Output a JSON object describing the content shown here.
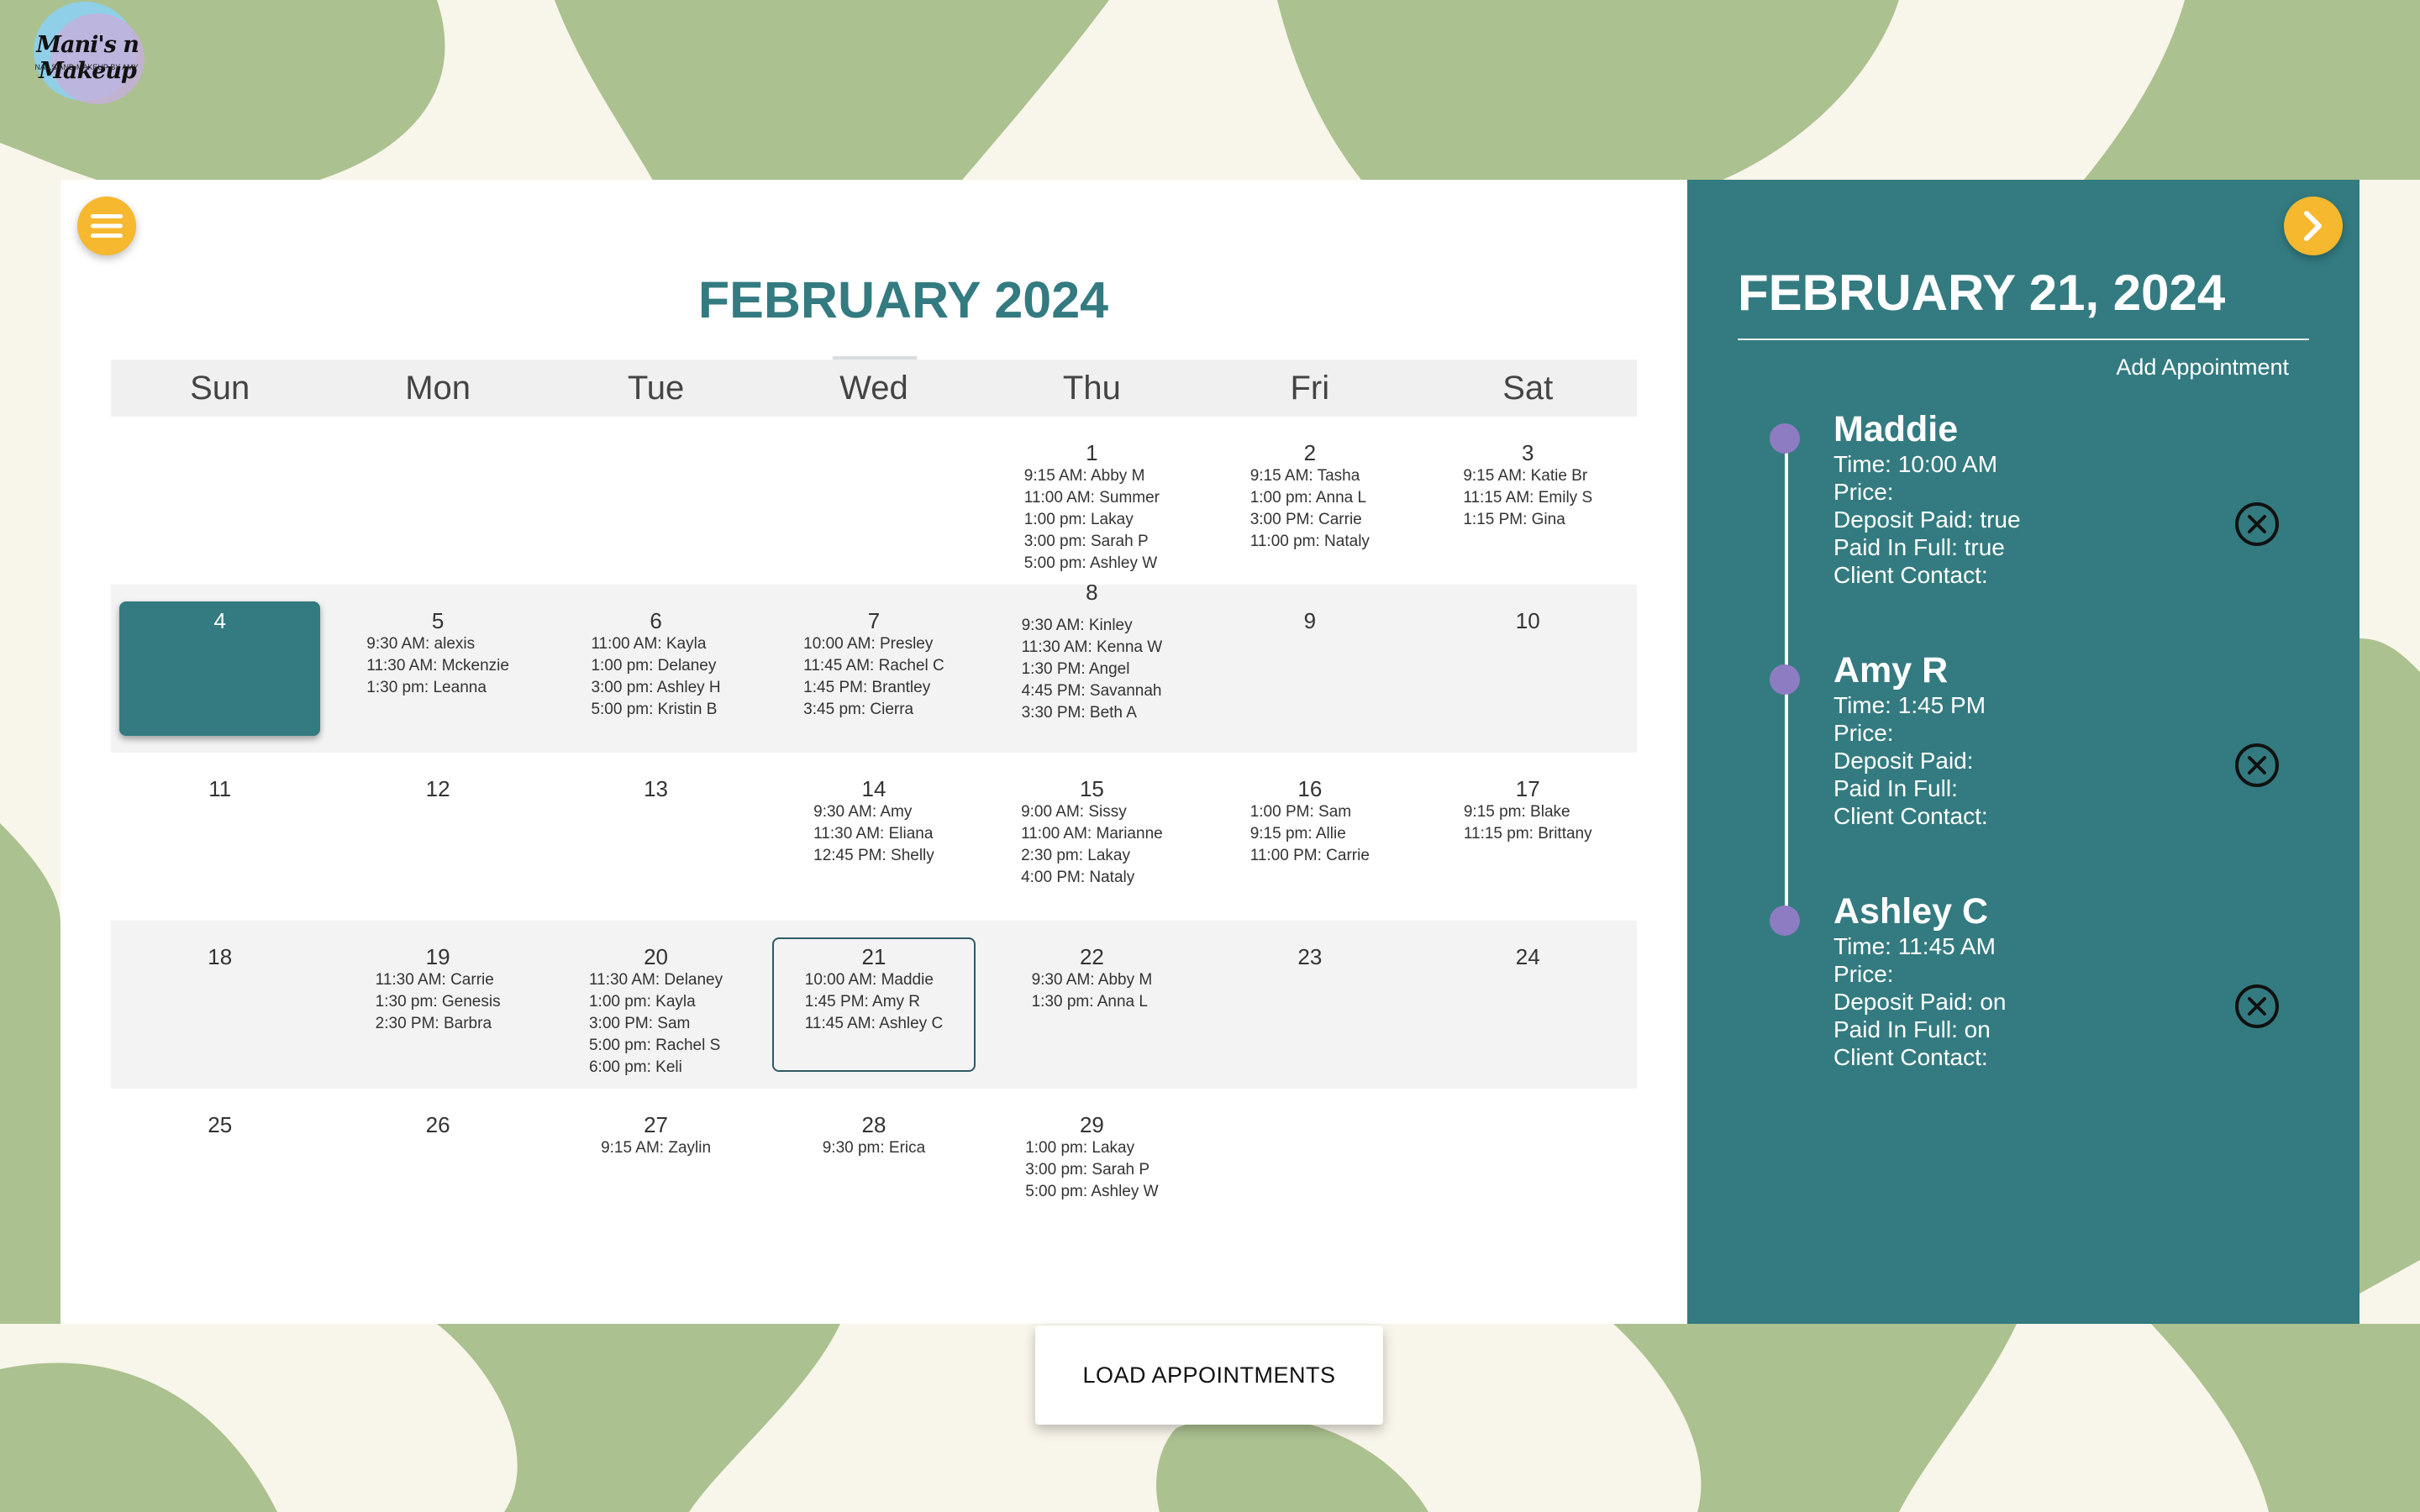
{
  "logo": {
    "name": "Mani's n Makeup",
    "tagline": "NAILS AND MAKEUP BY AMY"
  },
  "calendar": {
    "title": "FEBRUARY 2024",
    "days": [
      "Sun",
      "Mon",
      "Tue",
      "Wed",
      "Thu",
      "Fri",
      "Sat"
    ],
    "weeks": [
      [
        {
          "day": "",
          "appts": []
        },
        {
          "day": "",
          "appts": []
        },
        {
          "day": "",
          "appts": []
        },
        {
          "day": "",
          "appts": []
        },
        {
          "day": "1",
          "appts": [
            "9:15 AM: Abby M",
            "11:00 AM: Summer",
            "1:00 pm: Lakay",
            "3:00 pm: Sarah P",
            "5:00 pm: Ashley W"
          ]
        },
        {
          "day": "2",
          "appts": [
            "9:15 AM: Tasha",
            "1:00 pm: Anna L",
            "3:00 PM: Carrie",
            "11:00 pm: Nataly"
          ]
        },
        {
          "day": "3",
          "appts": [
            "9:15 AM: Katie Br",
            "11:15 AM: Emily S",
            "1:15 PM: Gina"
          ]
        }
      ],
      [
        {
          "day": "4",
          "appts": [],
          "today": true
        },
        {
          "day": "5",
          "appts": [
            "9:30 AM: alexis",
            "11:30 AM: Mckenzie",
            "1:30 pm: Leanna"
          ]
        },
        {
          "day": "6",
          "appts": [
            "11:00 AM: Kayla",
            "1:00 pm: Delaney",
            "3:00 pm: Ashley H",
            "5:00 pm: Kristin B"
          ]
        },
        {
          "day": "7",
          "appts": [
            "10:00 AM: Presley",
            "11:45 AM: Rachel C",
            "1:45 PM: Brantley",
            "3:45 pm: Cierra"
          ]
        },
        {
          "day": "8",
          "appts": [
            "9:30 AM: Kinley",
            "11:30 AM: Kenna W",
            "1:30 PM: Angel",
            "4:45 PM: Savannah",
            "3:30 PM: Beth A"
          ],
          "overflow": true
        },
        {
          "day": "9",
          "appts": []
        },
        {
          "day": "10",
          "appts": []
        }
      ],
      [
        {
          "day": "11",
          "appts": []
        },
        {
          "day": "12",
          "appts": []
        },
        {
          "day": "13",
          "appts": []
        },
        {
          "day": "14",
          "appts": [
            "9:30 AM: Amy",
            "11:30 AM: Eliana",
            "12:45 PM: Shelly"
          ]
        },
        {
          "day": "15",
          "appts": [
            "9:00 AM: Sissy",
            "11:00 AM: Marianne",
            "2:30 pm: Lakay",
            "4:00 PM: Nataly"
          ]
        },
        {
          "day": "16",
          "appts": [
            "1:00 PM: Sam",
            "9:15 pm: Allie",
            "11:00 PM: Carrie"
          ]
        },
        {
          "day": "17",
          "appts": [
            "9:15 pm: Blake",
            "11:15 pm: Brittany"
          ]
        }
      ],
      [
        {
          "day": "18",
          "appts": []
        },
        {
          "day": "19",
          "appts": [
            "11:30 AM: Carrie",
            "1:30 pm: Genesis",
            "2:30 PM: Barbra"
          ]
        },
        {
          "day": "20",
          "appts": [
            "11:30 AM: Delaney",
            "1:00 pm: Kayla",
            "3:00 PM: Sam",
            "5:00 pm: Rachel S",
            "6:00 pm: Keli"
          ]
        },
        {
          "day": "21",
          "appts": [
            "10:00 AM: Maddie",
            "1:45 PM: Amy R",
            "11:45 AM: Ashley C"
          ],
          "selected": true
        },
        {
          "day": "22",
          "appts": [
            "9:30 AM: Abby M",
            "1:30 pm: Anna L"
          ]
        },
        {
          "day": "23",
          "appts": []
        },
        {
          "day": "24",
          "appts": []
        }
      ],
      [
        {
          "day": "25",
          "appts": []
        },
        {
          "day": "26",
          "appts": []
        },
        {
          "day": "27",
          "appts": [
            "9:15 AM: Zaylin"
          ]
        },
        {
          "day": "28",
          "appts": [
            "9:30 pm: Erica"
          ]
        },
        {
          "day": "29",
          "appts": [
            "1:00 pm: Lakay",
            "3:00 pm: Sarah P",
            "5:00 pm: Ashley W"
          ]
        },
        {
          "day": "",
          "appts": []
        },
        {
          "day": "",
          "appts": []
        }
      ]
    ]
  },
  "panel": {
    "title": "FEBRUARY 21, 2024",
    "add_label": "Add Appointment",
    "appointments": [
      {
        "name": "Maddie",
        "time": "Time: 10:00 AM",
        "price": "Price:",
        "deposit": "Deposit Paid: true",
        "paid": "Paid In Full: true",
        "contact": "Client Contact:"
      },
      {
        "name": "Amy R",
        "time": "Time: 1:45 PM",
        "price": "Price:",
        "deposit": "Deposit Paid:",
        "paid": "Paid In Full:",
        "contact": "Client Contact:"
      },
      {
        "name": "Ashley C",
        "time": "Time: 11:45 AM",
        "price": "Price:",
        "deposit": "Deposit Paid: on",
        "paid": "Paid In Full: on",
        "contact": "Client Contact:"
      }
    ]
  },
  "load_button": "LOAD APPOINTMENTS",
  "colors": {
    "teal": "#337b80",
    "accent": "#f5b82e",
    "dot": "#8e7cc3",
    "leaf": "#abc18f",
    "background": "#f8f5ea"
  },
  "icons": {
    "menu": "hamburger-menu-icon",
    "next": "chevron-right-icon",
    "delete": "close-circle-icon"
  }
}
